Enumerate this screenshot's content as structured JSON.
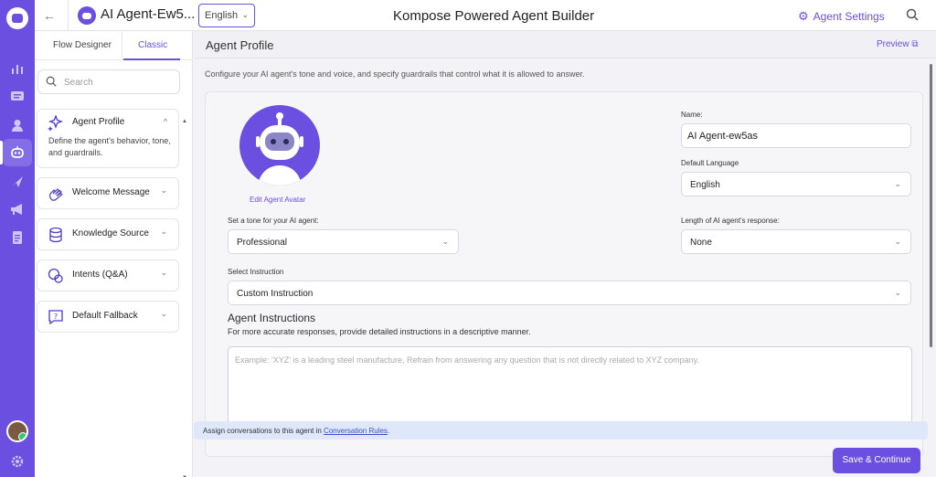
{
  "header": {
    "agent_name": "AI Agent-Ew5...",
    "language": "English",
    "title": "Kompose Powered Agent Builder",
    "settings_label": "Agent Settings"
  },
  "left_panel": {
    "tabs": [
      "Flow Designer",
      "Classic"
    ],
    "active_tab": "Classic",
    "search_placeholder": "Search",
    "cards": [
      {
        "label": "Agent Profile",
        "icon": "sparkles-icon",
        "expanded": true,
        "description": "Define the agent's behavior, tone, and guardrails."
      },
      {
        "label": "Welcome Message",
        "icon": "wave-hand-icon",
        "expanded": false
      },
      {
        "label": "Knowledge Source",
        "icon": "database-icon",
        "expanded": false
      },
      {
        "label": "Intents (Q&A)",
        "icon": "chat-bubbles-icon",
        "expanded": false
      },
      {
        "label": "Default Fallback",
        "icon": "question-bubble-icon",
        "expanded": false
      }
    ]
  },
  "main": {
    "heading": "Agent Profile",
    "preview_label": "Preview",
    "intro": "Configure your AI agent's tone and voice, and specify guardrails that control what it is allowed to answer.",
    "edit_avatar": "Edit Agent Avatar",
    "name_label": "Name:",
    "name_value": "AI Agent-ew5as",
    "default_language_label": "Default Language",
    "default_language_value": "English",
    "tone_label": "Set a tone for your AI agent:",
    "tone_value": "Professional",
    "length_label": "Length of AI agent's response:",
    "length_value": "None",
    "instruction_label": "Select Instruction",
    "instruction_value": "Custom Instruction",
    "instructions_title": "Agent Instructions",
    "instructions_sub": "For more accurate responses, provide detailed instructions in a descriptive manner.",
    "instructions_placeholder": "Example: 'XYZ' is a leading steel manufacture, Refrain from answering any question that is not directly related to XYZ company.",
    "notice_text": "Assign conversations to this agent in ",
    "notice_link": "Conversation Rules",
    "notice_end": ".",
    "save_button": "Save & Continue"
  },
  "colors": {
    "accent": "#6a4fe0",
    "rail": "#6a4fe0",
    "notice_bg": "#dfe8fb"
  }
}
